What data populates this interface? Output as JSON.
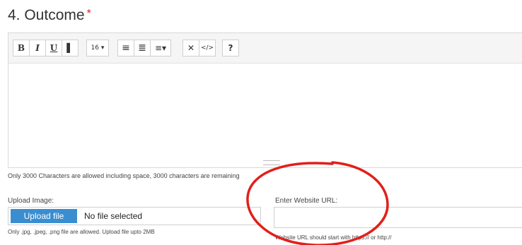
{
  "section": {
    "title": "4. Outcome",
    "required_mark": "*"
  },
  "toolbar": {
    "bold": "B",
    "italic": "I",
    "underline": "U",
    "clear_format": "▌",
    "font_size": "16 ▾",
    "unordered_list": "≡",
    "ordered_list": "≣",
    "paragraph": "≡▾",
    "fullscreen": "✕",
    "code_view": "</>",
    "help": "?"
  },
  "editor": {
    "char_note": "Only 3000 Characters are allowed including space, 3000 characters are remaining"
  },
  "upload": {
    "label": "Upload Image:",
    "button": "Upload file",
    "status": "No file selected",
    "note": "Only .jpg, .jpeg, .png file are allowed. Upload file upto 2MB"
  },
  "website": {
    "label": "Enter Website URL:",
    "value": "",
    "note": "Website URL should start with https:// or http://"
  },
  "colors": {
    "upload_button": "#3a8ed0",
    "required": "#e02020",
    "annotation": "#e0201a"
  }
}
